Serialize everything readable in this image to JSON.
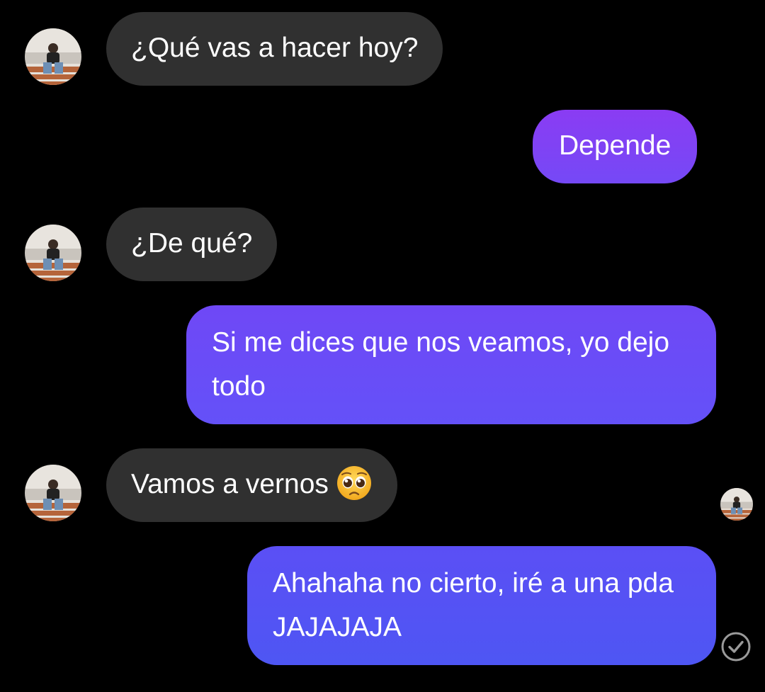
{
  "conversation": {
    "messages": [
      {
        "id": "m1",
        "direction": "received",
        "text": "¿Qué vas a hacer hoy?"
      },
      {
        "id": "m2",
        "direction": "sent",
        "text": "Depende"
      },
      {
        "id": "m3",
        "direction": "received",
        "text": "¿De qué?"
      },
      {
        "id": "m4",
        "direction": "sent",
        "text": "Si me dices que nos veamos, yo dejo todo"
      },
      {
        "id": "m5",
        "direction": "received",
        "text": "Vamos a vernos",
        "emoji": "pleading-face"
      },
      {
        "id": "m6",
        "direction": "sent",
        "text": "Ahahaha no cierto, iré a una pda JAJAJAJA"
      }
    ],
    "seen_indicator": "contact-avatar-small",
    "status_icon": "check-circle-icon"
  },
  "colors": {
    "background": "#000000",
    "received_bubble": "#303030",
    "sent_bubble_top": "#8a3cf3",
    "sent_bubble_bottom": "#4e56f3",
    "text": "#ffffff"
  }
}
